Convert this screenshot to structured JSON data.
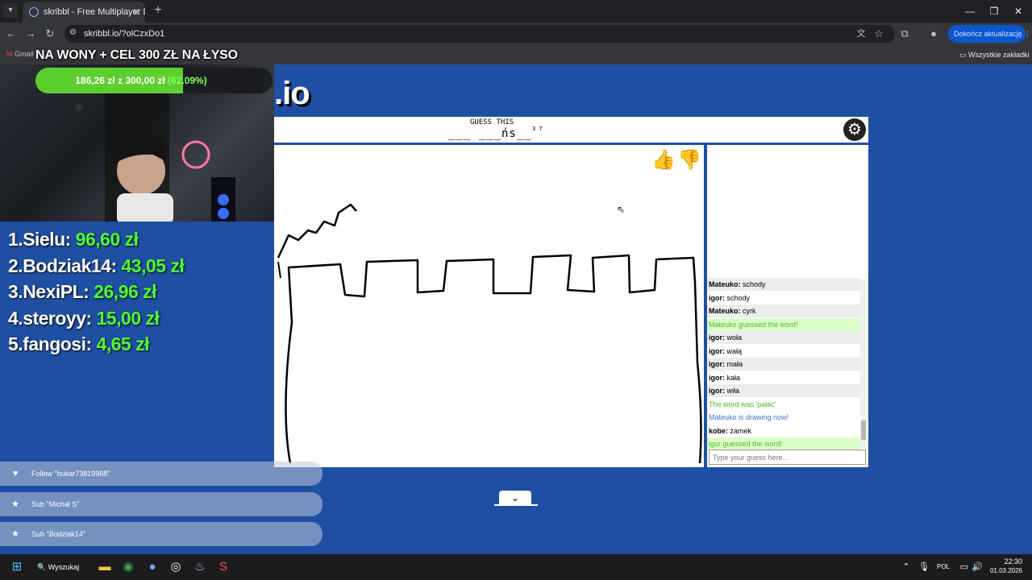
{
  "browser": {
    "tab_title": "skribbl - Free Multiplayer Drawing",
    "url": "skribbl.io/?olCzxDo1",
    "update_button": "Dokończ aktualizację",
    "bookmarks_label": "Wszystkie zakładki",
    "gmail_bookmark": "Gmail"
  },
  "overlay": {
    "goal_title": "NA WONY + CEL 300 ZŁ NA ŁYSO",
    "goal_amount": "186,26 zł",
    "goal_of": "z",
    "goal_target": "300,00 zł",
    "goal_percent": "(62.09%)",
    "goal_fraction": 0.6209,
    "leaderboard": [
      {
        "rank": "1.",
        "name": "Sielu:",
        "amount": "96,60 zł"
      },
      {
        "rank": "2.",
        "name": "Bodziak14:",
        "amount": "43,05 zł"
      },
      {
        "rank": "3.",
        "name": "NexiPL:",
        "amount": "26,96 zł"
      },
      {
        "rank": "4.",
        "name": "steroyy:",
        "amount": "15,00 zł"
      },
      {
        "rank": "5.",
        "name": "fangosi:",
        "amount": "4,65 zł"
      }
    ],
    "alerts": [
      {
        "icon": "heart-icon",
        "text": "Follow \"bukar73819968\""
      },
      {
        "icon": "star-icon",
        "text": "Sub \"Michał S\""
      },
      {
        "icon": "star-icon",
        "text": "Sub \"Bodziak14\""
      }
    ]
  },
  "game": {
    "logo": ".io",
    "guess_label": "GUESS THIS",
    "word_hint": "___ ___ńs__",
    "word_lengths": "3 7",
    "chat": [
      {
        "user": "Mateuko:",
        "text": "schody",
        "style": "alt"
      },
      {
        "user": "igor:",
        "text": "schody",
        "style": "plain"
      },
      {
        "user": "Mateuko:",
        "text": "cyrk",
        "style": "alt"
      },
      {
        "user": "",
        "text": "Mateuko guessed the word!",
        "style": "ok"
      },
      {
        "user": "igor:",
        "text": "woła",
        "style": "alt"
      },
      {
        "user": "igor:",
        "text": "wałą",
        "style": "plain"
      },
      {
        "user": "igor:",
        "text": "mała",
        "style": "alt"
      },
      {
        "user": "igor:",
        "text": "kała",
        "style": "plain"
      },
      {
        "user": "igor:",
        "text": "wiła",
        "style": "alt"
      },
      {
        "user": "",
        "text": "The word was 'pałac'",
        "style": "ok2"
      },
      {
        "user": "",
        "text": "Mateuko is drawing now!",
        "style": "info"
      },
      {
        "user": "kobe:",
        "text": "zamek",
        "style": "plain"
      },
      {
        "user": "",
        "text": "igor guessed the word!",
        "style": "ok"
      }
    ],
    "chat_placeholder": "Type your guess here..."
  },
  "taskbar": {
    "search_label": "Wyszukaj",
    "language": "POL",
    "time": "22:30",
    "date": "01.03.2026"
  }
}
